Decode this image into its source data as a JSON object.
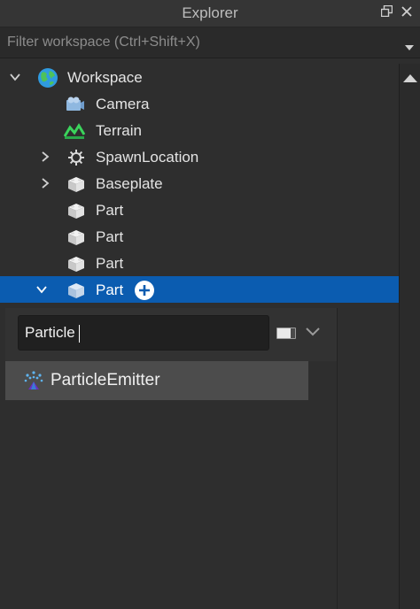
{
  "panel": {
    "title": "Explorer"
  },
  "filter": {
    "placeholder": "Filter workspace (Ctrl+Shift+X)"
  },
  "tree": {
    "workspace": "Workspace",
    "camera": "Camera",
    "terrain": "Terrain",
    "spawn_location": "SpawnLocation",
    "baseplate": "Baseplate",
    "part1": "Part",
    "part2": "Part",
    "part3": "Part",
    "part_selected": "Part"
  },
  "insert_search": {
    "value": "Particle"
  },
  "results": [
    {
      "label": "ParticleEmitter",
      "icon": "particle-emitter-icon"
    }
  ],
  "colors": {
    "selection": "#0b5cb0",
    "background": "#2e2e2e",
    "hover": "#4c4c4c"
  }
}
